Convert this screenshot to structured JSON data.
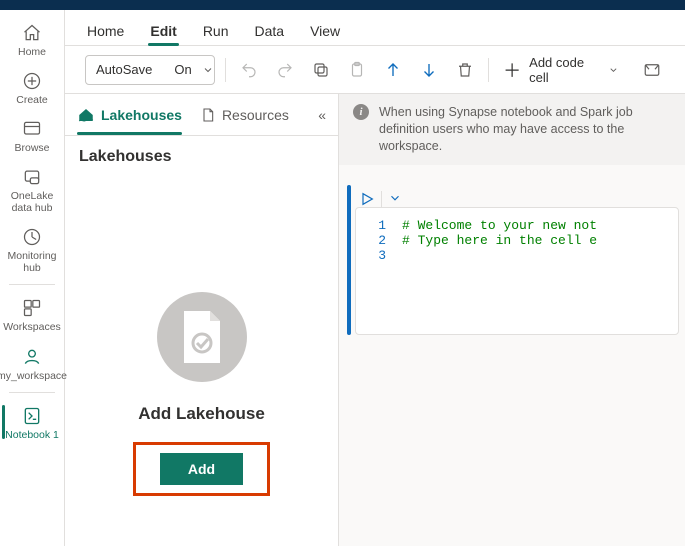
{
  "leftnav": {
    "items": [
      {
        "label": "Home"
      },
      {
        "label": "Create"
      },
      {
        "label": "Browse"
      },
      {
        "label": "OneLake data hub"
      },
      {
        "label": "Monitoring hub"
      },
      {
        "label": "Workspaces"
      },
      {
        "label": "my_workspace"
      },
      {
        "label": "Notebook 1"
      }
    ]
  },
  "ribbon": {
    "tabs": [
      {
        "label": "Home"
      },
      {
        "label": "Edit"
      },
      {
        "label": "Run"
      },
      {
        "label": "Data"
      },
      {
        "label": "View"
      }
    ]
  },
  "toolbar": {
    "autosave_label": "AutoSave",
    "autosave_value": "On",
    "add_code_cell": "Add code cell"
  },
  "side": {
    "tabs": {
      "lakehouses": "Lakehouses",
      "resources": "Resources"
    },
    "header": "Lakehouses",
    "empty_title": "Add Lakehouse",
    "add_button": "Add"
  },
  "editor": {
    "banner": "When using Synapse notebook and Spark job definition users who may have access to the workspace.",
    "lines": {
      "l1": "# Welcome to your new not",
      "l2": "# Type here in the cell e",
      "n1": "1",
      "n2": "2",
      "n3": "3"
    }
  }
}
